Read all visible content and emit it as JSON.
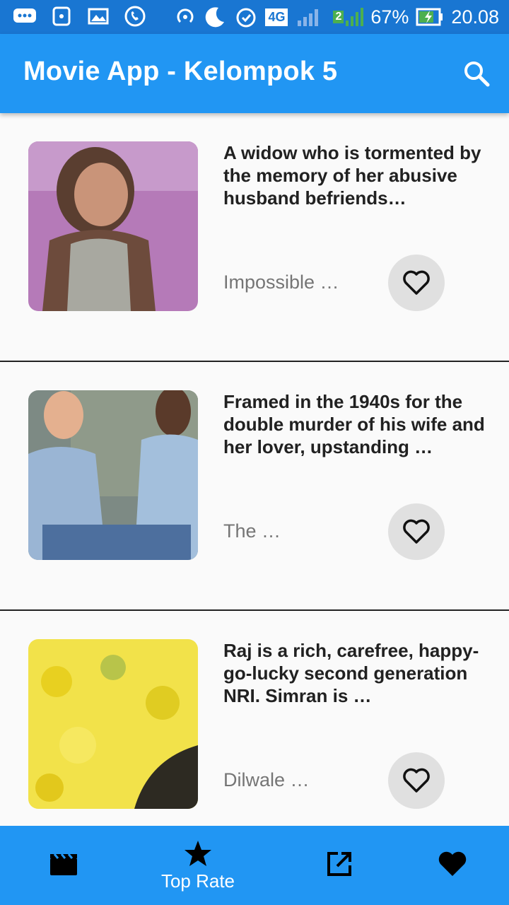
{
  "status_bar": {
    "battery": "67%",
    "time": "20.08",
    "network": "4G",
    "sim_slot": "2",
    "icons": [
      "chat-icon",
      "hotspot-icon",
      "gallery-icon",
      "whatsapp-icon",
      "wifi-hotspot-icon",
      "moon-icon",
      "alarm-icon"
    ]
  },
  "app_bar": {
    "title": "Movie App - Kelompok 5",
    "search_icon": "search-icon"
  },
  "movies": [
    {
      "description": "A widow who is tormented by the memory of her abusive husband befriends…",
      "title": "Impossible …",
      "poster_tone": [
        "#b57ab8",
        "#6d4b3c"
      ],
      "favorite_icon": "heart-outline-icon"
    },
    {
      "description": "Framed in the 1940s for the double murder of his wife and her lover, upstanding …",
      "title": "The …",
      "poster_tone": [
        "#7d8a84",
        "#6f8fb8"
      ],
      "favorite_icon": "heart-outline-icon"
    },
    {
      "description": "Raj is a rich, carefree, happy-go-lucky second generation NRI. Simran is …",
      "title": "Dilwale …",
      "poster_tone": [
        "#f2e24a",
        "#2d2a22"
      ],
      "favorite_icon": "heart-outline-icon"
    }
  ],
  "bottom_nav": [
    {
      "icon": "movie-clapper-icon",
      "label": ""
    },
    {
      "icon": "star-icon",
      "label": "Top Rate"
    },
    {
      "icon": "open-external-icon",
      "label": ""
    },
    {
      "icon": "heart-filled-icon",
      "label": ""
    }
  ],
  "colors": {
    "status_bar": "#1976d2",
    "app_bar": "#2196f3",
    "bottom_nav": "#2196f3",
    "fav_button_bg": "#e0e0e0"
  }
}
